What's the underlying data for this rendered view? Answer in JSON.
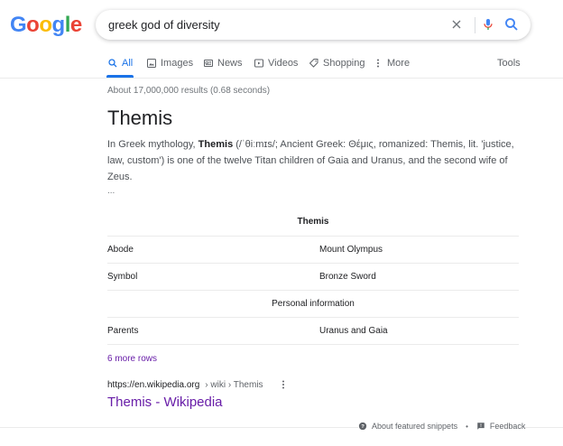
{
  "logo": [
    "G",
    "o",
    "o",
    "g",
    "l",
    "e"
  ],
  "logo_colors": [
    "#4285f4",
    "#ea4335",
    "#fbbc05",
    "#4285f4",
    "#34a853",
    "#ea4335"
  ],
  "search": {
    "query": "greek god of diversity"
  },
  "tabs": [
    {
      "label": "All",
      "icon": "search-icon"
    },
    {
      "label": "Images",
      "icon": "image-icon"
    },
    {
      "label": "News",
      "icon": "news-icon"
    },
    {
      "label": "Videos",
      "icon": "video-icon"
    },
    {
      "label": "Shopping",
      "icon": "tag-icon"
    },
    {
      "label": "More",
      "icon": "more-vert-icon"
    }
  ],
  "tools_label": "Tools",
  "stats": "About 17,000,000 results (0.68 seconds)",
  "featured": {
    "title": "Themis",
    "desc_pre": "In Greek mythology, ",
    "desc_bold": "Themis",
    "desc_post": " (/ˈθiːmɪs/; Ancient Greek: Θέμις, romanized: Themis, lit. 'justice, law, custom') is one of the twelve Titan children of Gaia and Uranus, and the second wife of Zeus.",
    "ellipsis": "..."
  },
  "infobox": {
    "header": "Themis",
    "rows": [
      {
        "label": "Abode",
        "value": "Mount Olympus"
      },
      {
        "label": "Symbol",
        "value": "Bronze Sword"
      }
    ],
    "section": "Personal information",
    "rows2": [
      {
        "label": "Parents",
        "value": "Uranus and Gaia"
      }
    ]
  },
  "more_rows": "6 more rows",
  "result": {
    "url": "https://en.wikipedia.org",
    "crumb": "› wiki › Themis",
    "title": "Themis - Wikipedia"
  },
  "footer": {
    "about": "About featured snippets",
    "bullet": "•",
    "feedback": "Feedback"
  },
  "colors": {
    "link_visited": "#681da8",
    "accent": "#1a73e8"
  }
}
